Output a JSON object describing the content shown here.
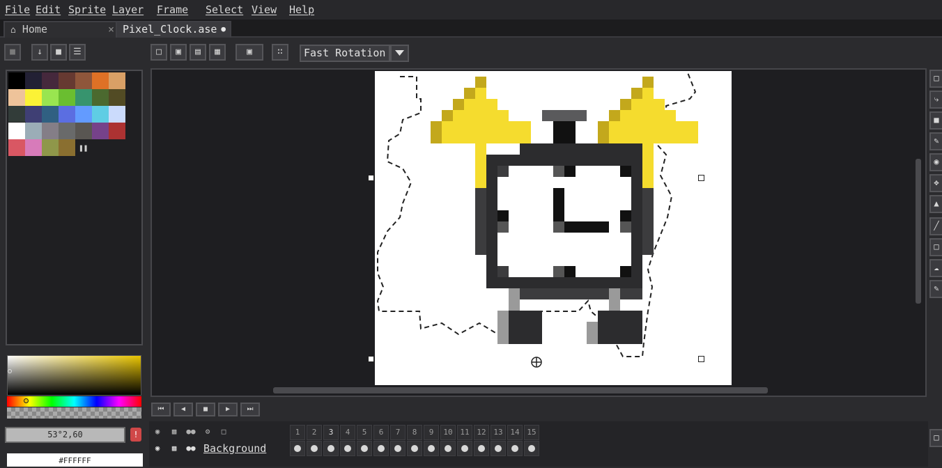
{
  "menu": {
    "items": [
      "File",
      "Edit",
      "Sprite",
      "Layer",
      "Frame",
      "Select",
      "View",
      "Help"
    ]
  },
  "tabs": [
    {
      "label": "Home",
      "icon": "home-icon",
      "close": "×"
    },
    {
      "label": "Pixel_Clock.ase",
      "modified": "●"
    }
  ],
  "toolbar": {
    "rotation_algorithm": "Fast Rotation"
  },
  "palette": {
    "colors": [
      "#000000",
      "#222034",
      "#45283c",
      "#663931",
      "#8f563b",
      "#df7126",
      "#d9a066",
      "#eec39a",
      "#fbf236",
      "#99e550",
      "#6abe30",
      "#37946e",
      "#4b692f",
      "#524b24",
      "#323c39",
      "#3f3f74",
      "#306082",
      "#5b6ee1",
      "#639bff",
      "#5fcde4",
      "#cbdbfc",
      "#ffffff",
      "#9badb7",
      "#847e87",
      "#696a6a",
      "#595652",
      "#76428a",
      "#ac3232",
      "#d95763",
      "#d77bba",
      "#8f974a",
      "#8a6f30"
    ]
  },
  "color_picker": {
    "hsv_value": "53°2,60",
    "hex_value": "#FFFFFF",
    "warning": "!"
  },
  "timeline": {
    "frames": [
      "1",
      "2",
      "3",
      "4",
      "5",
      "6",
      "7",
      "8",
      "9",
      "10",
      "11",
      "12",
      "13",
      "14",
      "15"
    ],
    "active_frame": "3",
    "layer_name": "Background"
  },
  "colors": {
    "bell_yellow": "#f5dc2e",
    "bell_shadow": "#c3a81c",
    "frame_dark": "#2c2c2e",
    "frame_mid": "#3c3c3e",
    "canvas_bg": "#ffffff"
  }
}
